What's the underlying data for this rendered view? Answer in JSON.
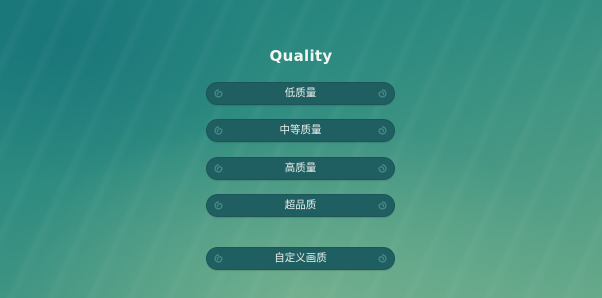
{
  "title": "Quality",
  "buttons": [
    {
      "label": "低质量"
    },
    {
      "label": "中等质量"
    },
    {
      "label": "高质量"
    },
    {
      "label": "超品质"
    },
    {
      "label": "自定义画质"
    }
  ],
  "icons": {
    "left": "swirl-ornament-icon",
    "right": "swirl-ornament-icon"
  },
  "colors": {
    "button_bg": "#1f5f62",
    "text": "#e9efea",
    "background_top": "#1d7e7c",
    "background_bottom": "#67a98a"
  }
}
